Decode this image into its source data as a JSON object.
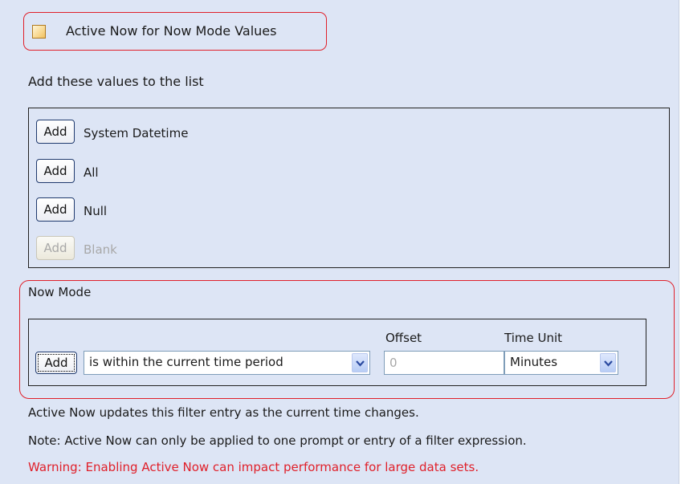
{
  "active_now": {
    "label": "Active Now for Now Mode Values",
    "checked": false
  },
  "add_values": {
    "heading": "Add these values to the list",
    "items": [
      {
        "button": "Add",
        "label": "System Datetime",
        "enabled": true
      },
      {
        "button": "Add",
        "label": "All",
        "enabled": true
      },
      {
        "button": "Add",
        "label": "Null",
        "enabled": true
      },
      {
        "button": "Add",
        "label": "Blank",
        "enabled": false
      }
    ]
  },
  "now_mode": {
    "title": "Now Mode",
    "add_button": "Add",
    "condition_select": "is within the current time period",
    "offset_label": "Offset",
    "offset_value": "0",
    "time_unit_label": "Time Unit",
    "time_unit_select": "Minutes"
  },
  "notes": {
    "info": "Active Now updates this filter entry as the current time changes.",
    "note": "Note: Active Now can only be applied to one prompt or entry of a filter expression.",
    "warning": "Warning: Enabling Active Now can impact performance for large data sets."
  },
  "colors": {
    "panel_bg": "#dde5f5",
    "highlight_outline": "#e0202a",
    "warning_text": "#e0202a",
    "disabled_text": "#a8a8a8"
  }
}
